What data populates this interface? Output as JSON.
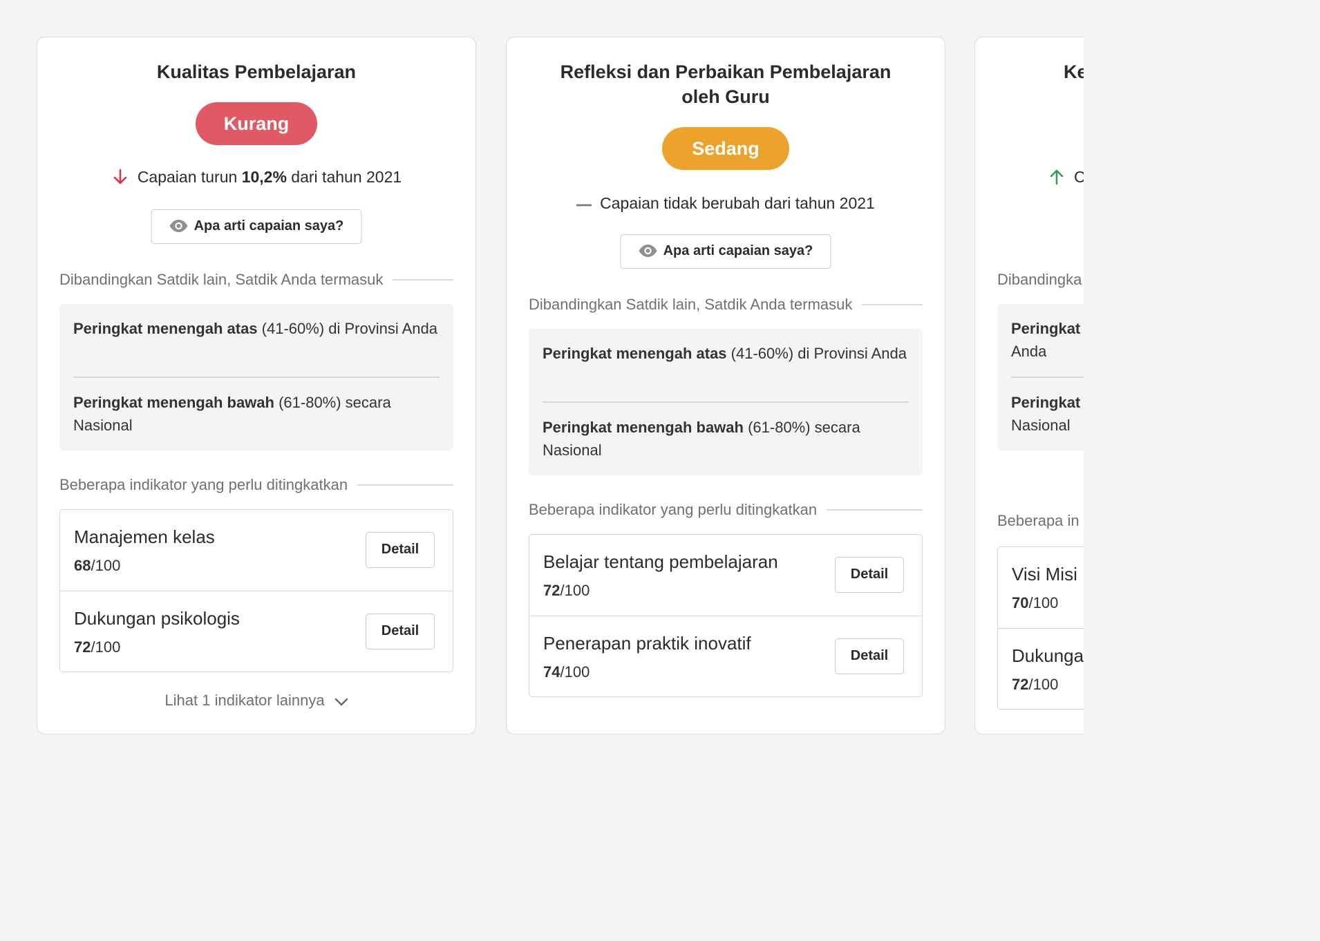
{
  "cards": [
    {
      "title": "Kualitas Pembelajaran",
      "badge": "Kurang",
      "badge_color": "#e05a66",
      "trend": {
        "direction": "down",
        "icon": "arrow-down-icon",
        "color": "#e0323e",
        "prefix": "Capaian turun ",
        "value": "10,2%",
        "suffix": " dari tahun 2021"
      },
      "meaning_button": "Apa arti capaian saya?",
      "compare_label": "Dibandingkan Satdik lain, Satdik Anda termasuk",
      "ranks": [
        {
          "bold": "Peringkat menengah atas",
          "rest": " (41-60%) di Provinsi Anda"
        },
        {
          "bold": "Peringkat menengah bawah",
          "rest": " (61-80%) secara Nasional"
        }
      ],
      "indicators_label": "Beberapa indikator yang perlu ditingkatkan",
      "indicators": [
        {
          "name": "Manajemen kelas",
          "score": "68",
          "max": "/100",
          "button": "Detail"
        },
        {
          "name": "Dukungan psikologis",
          "score": "72",
          "max": "/100",
          "button": "Detail"
        }
      ],
      "see_more": "Lihat 1 indikator lainnya"
    },
    {
      "title_line1": "Refleksi dan Perbaikan Pembelajaran",
      "title_line2": "oleh Guru",
      "badge": "Sedang",
      "badge_color": "#eda32b",
      "trend": {
        "direction": "flat",
        "icon": "dash-icon",
        "color": "#7a7a7a",
        "text": "Capaian tidak berubah dari tahun 2021"
      },
      "meaning_button": "Apa arti capaian saya?",
      "compare_label": "Dibandingkan Satdik lain, Satdik Anda termasuk",
      "ranks": [
        {
          "bold": "Peringkat menengah atas",
          "rest": " (41-60%) di Provinsi Anda"
        },
        {
          "bold": "Peringkat menengah bawah",
          "rest": " (61-80%) secara Nasional"
        }
      ],
      "indicators_label": "Beberapa indikator yang perlu ditingkatkan",
      "indicators": [
        {
          "name": "Belajar tentang pembelajaran",
          "score": "72",
          "max": "/100",
          "button": "Detail"
        },
        {
          "name": "Penerapan praktik inovatif",
          "score": "74",
          "max": "/100",
          "button": "Detail"
        }
      ]
    },
    {
      "title_partial": "Ke",
      "trend": {
        "direction": "up",
        "icon": "arrow-up-icon",
        "color": "#3a9a5c",
        "text_partial": "C"
      },
      "compare_label_partial": "Dibandingka",
      "ranks": [
        {
          "bold_partial": "Peringkat",
          "rest_partial": "Anda"
        },
        {
          "bold_partial": "Peringkat",
          "rest_partial": "Nasional"
        }
      ],
      "indicators_label_partial": "Beberapa in",
      "indicators": [
        {
          "name_partial": "Visi Misi",
          "score": "70",
          "max": "/100"
        },
        {
          "name_partial": "Dukunga",
          "score": "72",
          "max": "/100"
        }
      ]
    }
  ]
}
